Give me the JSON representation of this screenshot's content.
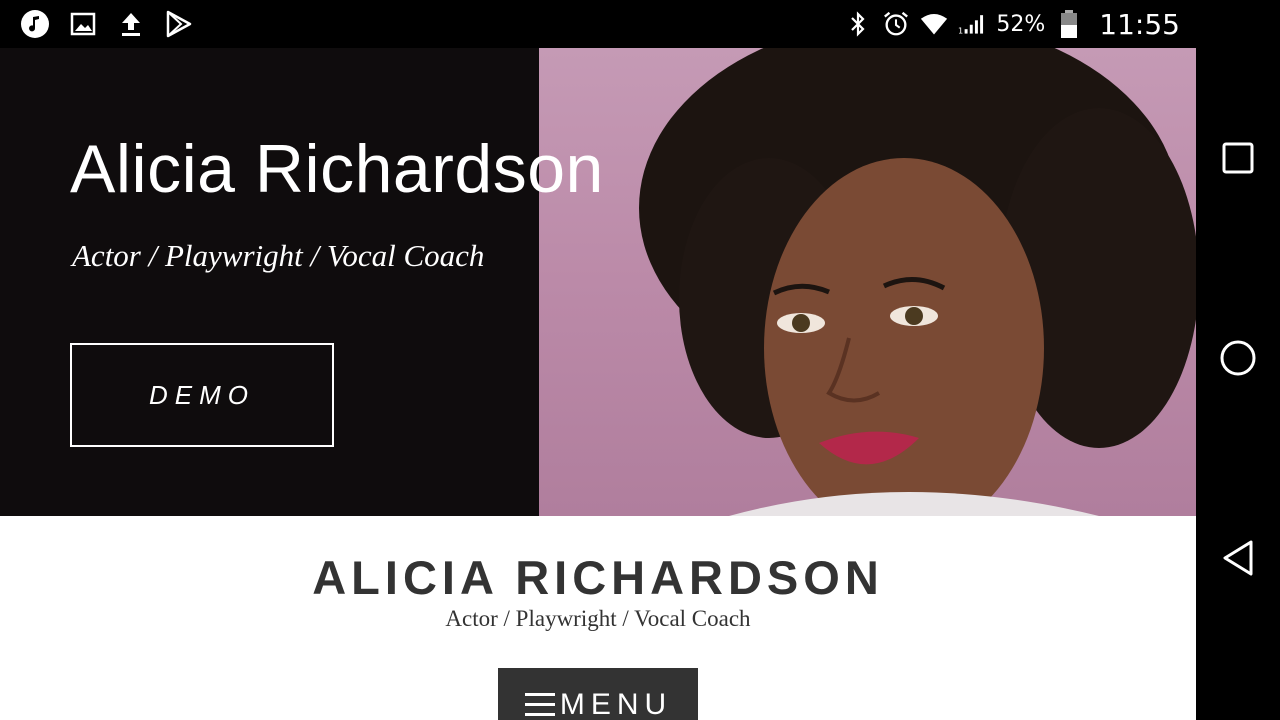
{
  "status_bar": {
    "left_icons": [
      "music-icon",
      "image-icon",
      "upload-icon",
      "play-store-icon"
    ],
    "right_icons": [
      "bluetooth-icon",
      "alarm-icon",
      "wifi-icon",
      "signal-icon",
      "battery-icon"
    ],
    "battery_percent": "52%",
    "time": "11:55"
  },
  "hero": {
    "title": "Alicia Richardson",
    "subtitle": "Actor / Playwright / Vocal Coach",
    "demo_label": "DEMO"
  },
  "header": {
    "site_name": "ALICIA RICHARDSON",
    "tagline": "Actor / Playwright / Vocal Coach",
    "menu_label": "MENU",
    "menu_icon": "hamburger-icon"
  },
  "nav_bar": {
    "buttons": [
      "recents-icon",
      "home-icon",
      "back-icon"
    ]
  },
  "colors": {
    "hero_background": "#0f0c0d",
    "photo_background": "#c59ab5",
    "header_text": "#333333",
    "menu_button": "#333333"
  }
}
